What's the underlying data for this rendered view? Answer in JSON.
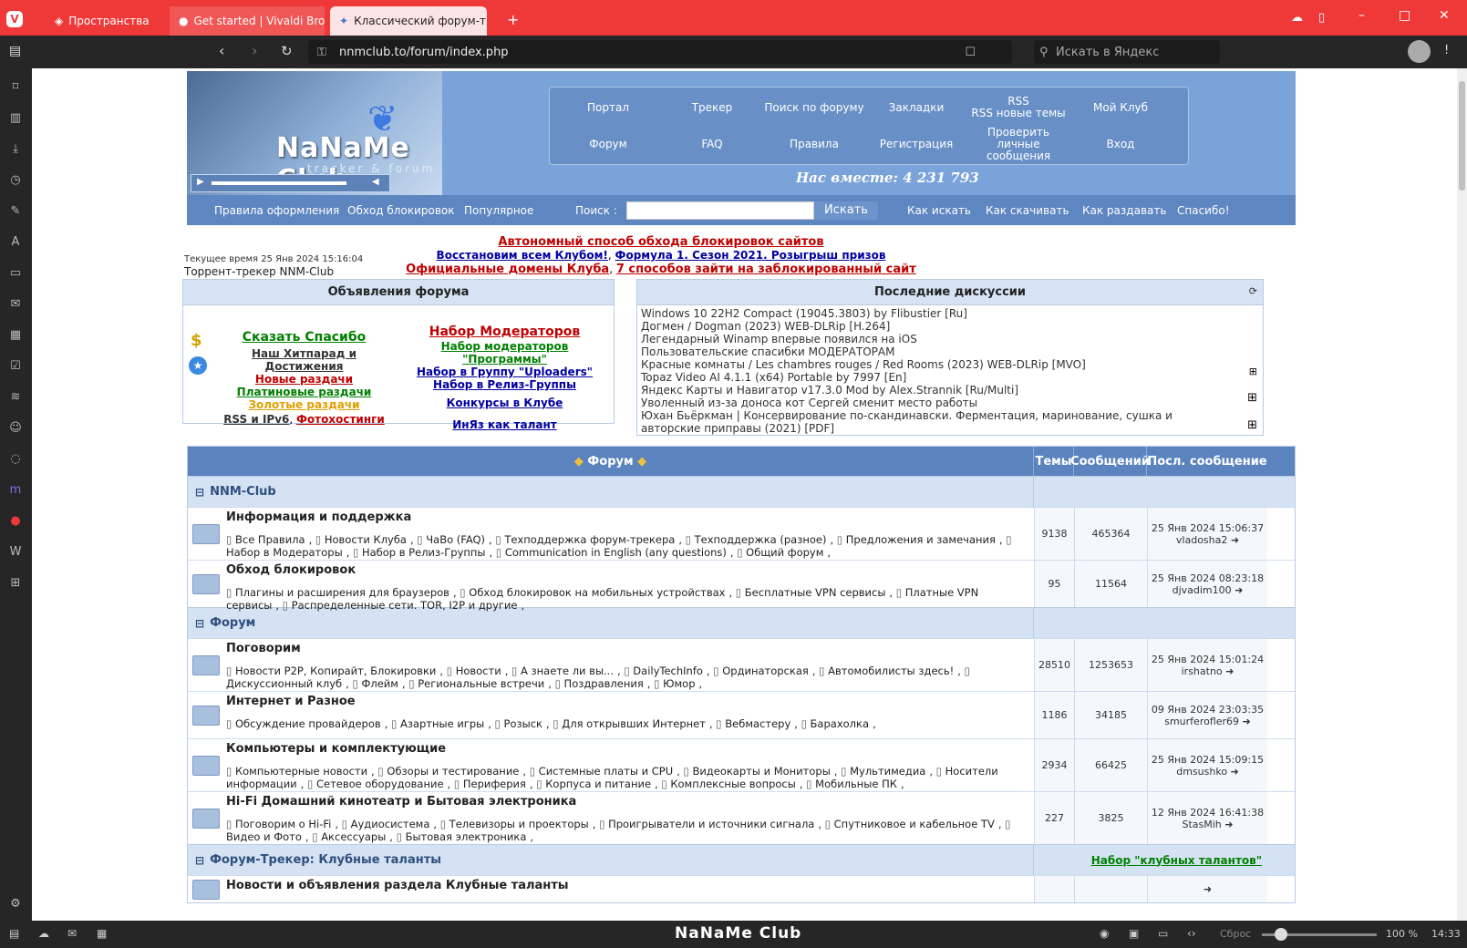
{
  "browser": {
    "tabs": [
      "Пространства",
      "Get started | Vivaldi Browser",
      "Классический форум-трекер"
    ],
    "url": "nnmclub.to/forum/index.php",
    "search_placeholder": "Искать в Яндекс",
    "status_title": "NaNaMe Club",
    "reset": "Сброс",
    "zoom": "100 %",
    "time": "14:33"
  },
  "header": {
    "logo": "NaNaMe Club",
    "logo_sub": "tracker & forum",
    "together": "Нас вместе: 4 231 793",
    "menu": [
      "Портал",
      "Трекер",
      "Поиск по форуму",
      "Закладки",
      "RSS\nRSS новые темы",
      "Мой Клуб",
      "Форум",
      "FAQ",
      "Правила",
      "Регистрация",
      "Проверить личные сообщения",
      "Вход"
    ],
    "nav": [
      "Правила оформления",
      "Обход блокировок",
      "Популярное",
      "Как искать",
      "Как скачивать",
      "Как раздавать",
      "Спасибо!"
    ],
    "search_label": "Поиск :",
    "search_button": "Искать"
  },
  "info": {
    "current_time": "Текущее время 25 Янв 2024 15:16:04",
    "tracker_name": "Торрент-трекер NNM-Club",
    "notice1": "Автономный способ обхода блокировок сайтов",
    "notice2a": "Восстановим всем Клубом!",
    "notice2b": "Формула 1. Сезон 2021. Розыгрыш призов",
    "notice3a": "Официальные домены Клуба",
    "notice3b": "7 способов зайти на заблокированный сайт"
  },
  "announce": {
    "title": "Объявления форума",
    "thanks": "Сказать Спасибо",
    "hitparade": "Наш Хитпарад и Достижения",
    "new": "Новые раздачи",
    "platinum": "Платиновые раздачи",
    "gold": "Золотые раздачи",
    "rss": "RSS и IPv6",
    "photo": "Фотохостинги",
    "moderators": "Набор Модераторов",
    "mod_prog": "Набор модераторов \"Программы\"",
    "uploaders": "Набор в Группу \"Uploaders\"",
    "release": "Набор в Релиз-Группы",
    "contests": "Конкурсы в Клубе",
    "talent": "ИнЯз как талант"
  },
  "discussions": {
    "title": "Последние дискуссии",
    "items": [
      "Windows 10 22H2 Compact (19045.3803) by Flibustier [Ru]",
      "Догмен / Dogman (2023) WEB-DLRip [H.264]",
      "Легендарный Winamp впервые появился на iOS",
      "Пользовательские спасибки МОДЕРАТОРАМ",
      "Красные комнаты / Les chambres rouges / Red Rooms (2023) WEB-DLRip [MVO]",
      "Topaz Video AI 4.1.1 (x64) Portable by 7997 [En]",
      "Яндекс Карты и Навигатор v17.3.0 Mod by Alex.Strannik [Ru/Multi]",
      "Уволенный из-за доноса кот Сергей сменит место работы",
      "Юхан Бьёркман | Консервирование по-скандинавски. Ферментация, маринование, сушка и авторские приправы (2021) [PDF]"
    ]
  },
  "forum": {
    "headers": {
      "forum": "Форум",
      "topics": "Темы",
      "posts": "Сообщений",
      "last": "Посл. сообщение"
    },
    "cats": [
      {
        "name": "NNM-Club",
        "link": "",
        "rows": [
          {
            "title": "Информация и поддержка",
            "subs": [
              "Все Правила",
              "Новости Клуба",
              "ЧаВо (FAQ)",
              "Техподдержка форум-трекера",
              "Техподдержка (разное)",
              "Предложения и замечания",
              "Набор в Модераторы",
              "Набор в Релиз-Группы",
              "Communication in English (any questions)",
              "Общий форум"
            ],
            "topics": "9138",
            "posts": "465364",
            "date": "25 Янв 2024 15:06:37",
            "user": "vladosha2"
          },
          {
            "title": "Обход блокировок",
            "subs": [
              "Плагины и расширения для браузеров",
              "Обход блокировок на мобильных устройствах",
              "Бесплатные VPN сервисы",
              "Платные VPN сервисы",
              "Распределенные сети. TOR, I2P и другие"
            ],
            "topics": "95",
            "posts": "11564",
            "date": "25 Янв 2024 08:23:18",
            "user": "djvadim100"
          }
        ]
      },
      {
        "name": "Форум",
        "link": "",
        "rows": [
          {
            "title": "Поговорим",
            "subs": [
              "Новости P2P, Копирайт, Блокировки",
              "Новости",
              "А знаете ли вы...",
              "DailyTechInfo",
              "Ординаторская",
              "Автомобилисты здесь!",
              "Дискуссионный клуб",
              "Флейм",
              "Региональные встречи",
              "Поздравления",
              "Юмор"
            ],
            "topics": "28510",
            "posts": "1253653",
            "date": "25 Янв 2024 15:01:24",
            "user": "irshatno"
          },
          {
            "title": "Интернет и Разное",
            "subs": [
              "Обсуждение провайдеров",
              "Азартные игры",
              "Розыск",
              "Для открывших Интернет",
              "Вебмастеру",
              "Барахолка"
            ],
            "topics": "1186",
            "posts": "34185",
            "date": "09 Янв 2024 23:03:35",
            "user": "smurferofler69"
          },
          {
            "title": "Компьютеры и комплектующие",
            "subs": [
              "Компьютерные новости",
              "Обзоры и тестирование",
              "Системные платы и CPU",
              "Видеокарты и Мониторы",
              "Мультимедиа",
              "Носители информации",
              "Сетевое оборудование",
              "Периферия",
              "Корпуса и питание",
              "Комплексные вопросы",
              "Мобильные ПК"
            ],
            "topics": "2934",
            "posts": "66425",
            "date": "25 Янв 2024 15:09:15",
            "user": "dmsushko"
          },
          {
            "title": "Hi-Fi Домашний кинотеатр и Бытовая электроника",
            "subs": [
              "Поговорим о Hi-Fi",
              "Аудиосистема",
              "Телевизоры и проекторы",
              "Проигрыватели и источники сигнала",
              "Спутниковое и кабельное TV",
              "Видео и Фото",
              "Аксессуары",
              "Бытовая электроника"
            ],
            "topics": "227",
            "posts": "3825",
            "date": "12 Янв 2024 16:41:38",
            "user": "StasMih"
          }
        ]
      },
      {
        "name": "Форум-Трекер: Клубные таланты",
        "link": "Набор \"клубных талантов\"",
        "rows": [
          {
            "title": "Новости и объявления раздела Клубные таланты",
            "subs": [],
            "topics": "",
            "posts": "",
            "date": "",
            "user": ""
          }
        ]
      }
    ]
  }
}
